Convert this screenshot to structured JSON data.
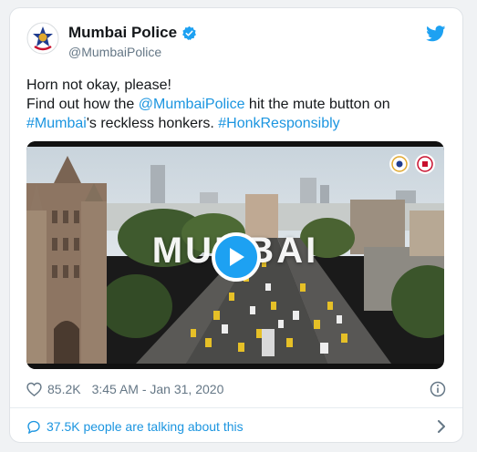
{
  "author": {
    "display_name": "Mumbai Police",
    "handle": "@MumbaiPolice",
    "verified": true,
    "avatar_icon": "police-badge-icon"
  },
  "brand": {
    "logo_icon": "twitter-bird-icon",
    "color": "#1da1f2"
  },
  "tweet": {
    "line1": "Horn not okay, please!",
    "line2_prefix": "Find out how the ",
    "mention": "@MumbaiPolice",
    "line2_suffix": " hit the mute button on",
    "hashtag1": "#Mumbai",
    "line3_middle": "'s reckless honkers. ",
    "hashtag2": "#HonkResponsibly",
    "link_color": "#1b95e0"
  },
  "media": {
    "title_overlay": "MUMBAI",
    "play_icon": "play-icon"
  },
  "meta": {
    "likes": "85.2K",
    "heart_icon": "heart-icon",
    "timestamp": "3:45 AM - Jan 31, 2020",
    "info_icon": "info-icon"
  },
  "footer": {
    "conversation_text": "37.5K people are talking about this",
    "comment_icon": "comment-icon",
    "chevron_icon": "chevron-right-icon"
  }
}
